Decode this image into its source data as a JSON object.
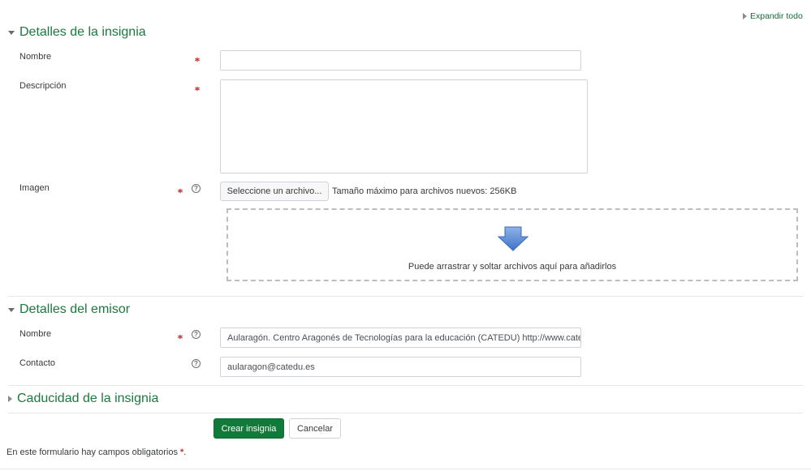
{
  "expand_all": "Expandir todo",
  "sections": {
    "badge_details": {
      "title": "Detalles de la insignia",
      "name_label": "Nombre",
      "name_value": "",
      "description_label": "Descripción",
      "description_value": "",
      "image_label": "Imagen",
      "choose_file_label": "Seleccione un archivo...",
      "max_size_text": "Tamaño máximo para archivos nuevos: 256KB",
      "dropzone_text": "Puede arrastrar y soltar archivos aquí para añadirlos"
    },
    "issuer_details": {
      "title": "Detalles del emisor",
      "name_label": "Nombre",
      "name_value": "Aularagón. Centro Aragonés de Tecnologías para la educación (CATEDU) http://www.catedu.es",
      "contact_label": "Contacto",
      "contact_value": "aularagon@catedu.es"
    },
    "expiry": {
      "title": "Caducidad de la insignia"
    }
  },
  "buttons": {
    "create": "Crear insignia",
    "cancel": "Cancelar"
  },
  "required_note": "En este formulario hay campos obligatorios",
  "required_mark": "*",
  "required_period": ".",
  "icons": {
    "required": "required-icon",
    "help": "help-icon",
    "arrow": "download-arrow-icon"
  },
  "colors": {
    "heading_green": "#1a7a3c",
    "primary_button": "#117a3a",
    "required_red": "#c9302c"
  }
}
